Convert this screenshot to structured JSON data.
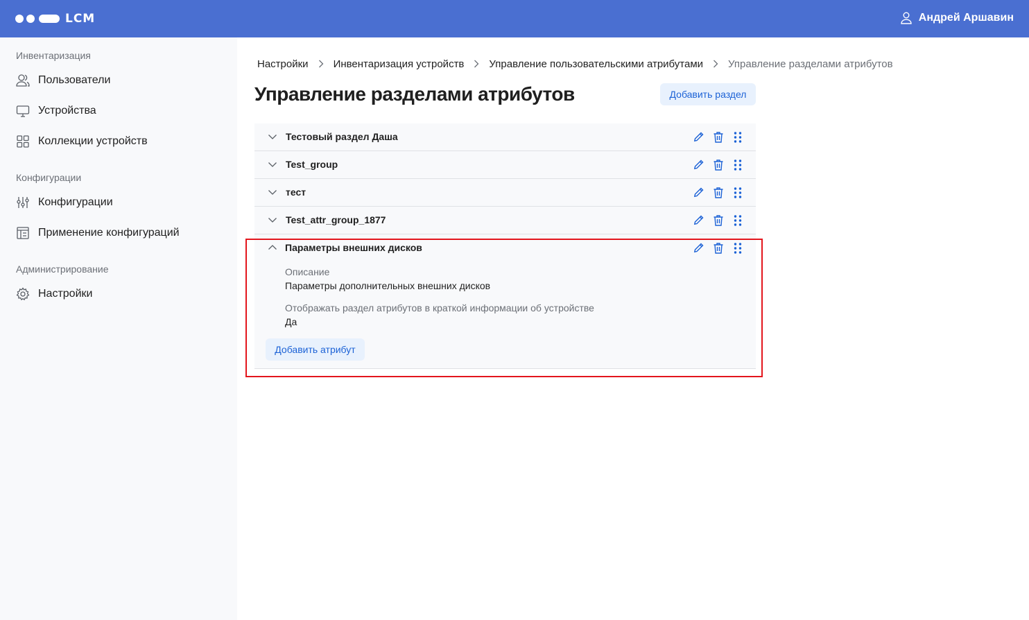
{
  "header": {
    "logo_text": "LCM",
    "user_name": "Андрей Аршавин"
  },
  "sidebar": {
    "sections": [
      {
        "title": "Инвентаризация",
        "items": [
          {
            "label": "Пользователи",
            "icon": "users-icon"
          },
          {
            "label": "Устройства",
            "icon": "monitor-icon"
          },
          {
            "label": "Коллекции устройств",
            "icon": "grid-icon"
          }
        ]
      },
      {
        "title": "Конфигурации",
        "items": [
          {
            "label": "Конфигурации",
            "icon": "sliders-icon"
          },
          {
            "label": "Применение конфигураций",
            "icon": "layout-icon"
          }
        ]
      },
      {
        "title": "Администрирование",
        "items": [
          {
            "label": "Настройки",
            "icon": "gear-icon"
          }
        ]
      }
    ]
  },
  "breadcrumb": [
    "Настройки",
    "Инвентаризация устройств",
    "Управление пользовательскими атрибутами",
    "Управление разделами атрибутов"
  ],
  "page": {
    "title": "Управление разделами атрибутов",
    "add_section_label": "Добавить раздел"
  },
  "sections": [
    {
      "title": "Тестовый раздел Даша",
      "expanded": false
    },
    {
      "title": "Test_group",
      "expanded": false
    },
    {
      "title": "тест",
      "expanded": false
    },
    {
      "title": "Test_attr_group_1877",
      "expanded": false
    },
    {
      "title": "Параметры внешних дисков",
      "expanded": true,
      "description_label": "Описание",
      "description_value": "Параметры дополнительных внешних дисков",
      "show_label": "Отображать раздел атрибутов в краткой информации об устройстве",
      "show_value": "Да",
      "add_attribute_label": "Добавить атрибут"
    }
  ],
  "colors": {
    "header_bg": "#4a6fd1",
    "accent": "#1c62d6",
    "highlight": "#e3151c"
  }
}
